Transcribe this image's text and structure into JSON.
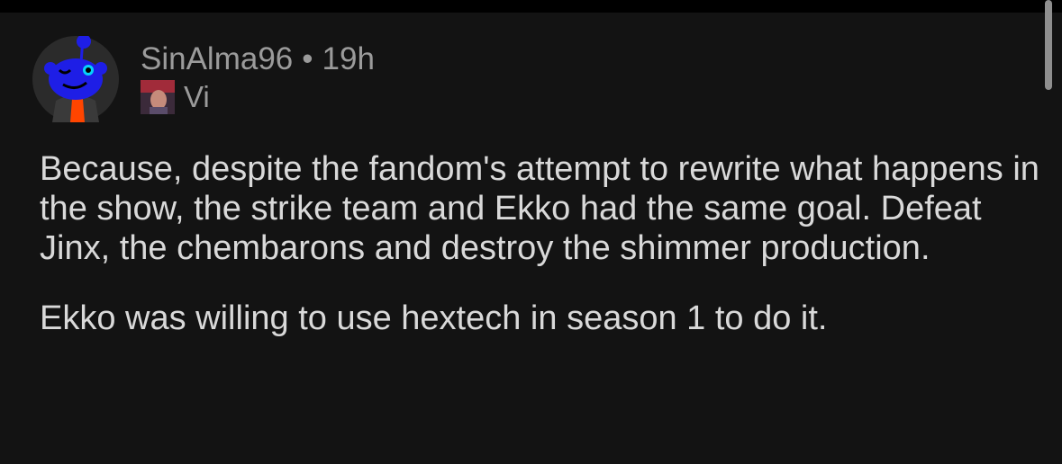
{
  "comment": {
    "author": "SinAlma96",
    "separator": "•",
    "time": "19h",
    "flair": "Vi",
    "paragraphs": [
      "Because, despite the fandom's attempt to rewrite what happens in the show, the strike team and Ekko had the same goal. Defeat Jinx, the chembarons and destroy the shimmer production.",
      "Ekko was willing to use hextech in season 1 to do it."
    ]
  },
  "colors": {
    "background": "#131313",
    "meta_text": "#9b9b9b",
    "body_text": "#d9d9d9",
    "avatar_blue": "#1e1ee6",
    "avatar_orange": "#ff4500"
  },
  "icons": {
    "avatar": "reddit-snoo-avatar",
    "flair": "vi-flair-icon"
  }
}
